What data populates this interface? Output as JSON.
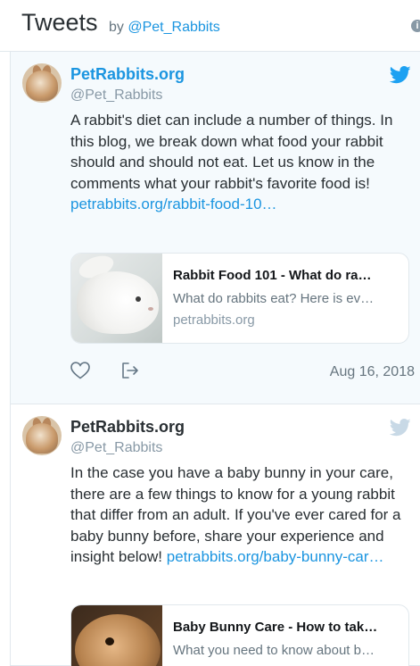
{
  "header": {
    "title": "Tweets",
    "by_label": "by",
    "handle": "@Pet_Rabbits",
    "info_icon": "info-icon"
  },
  "colors": {
    "link": "#1b95e0",
    "highlight_bg": "#f5fafd",
    "muted": "#8899a6"
  },
  "tweets": [
    {
      "name": "PetRabbits.org",
      "handle": "@Pet_Rabbits",
      "text": "A rabbit's diet can include a number of things. In this blog, we break down what food your rabbit should and should not eat. Let us know in the comments what your rabbit's favorite food is! ",
      "link": "petrabbits.org/rabbit-food-10…",
      "card": {
        "title": "Rabbit Food 101 - What do ra…",
        "description": "What do rabbits eat? Here is ev…",
        "domain": "petrabbits.org"
      },
      "date": "Aug 16, 2018",
      "icons": [
        "rabbit-avatar",
        "twitter-bird-icon",
        "heart-icon",
        "share-icon"
      ]
    },
    {
      "name": "PetRabbits.org",
      "handle": "@Pet_Rabbits",
      "text": "In the case you have a baby bunny in your care, there are a few things to know for a young rabbit that differ from an adult. If you've ever cared for a baby bunny before, share your experience and insight below! ",
      "link": "petrabbits.org/baby-bunny-car…",
      "card": {
        "title": "Baby Bunny Care - How to tak…",
        "description": "What you need to know about b…"
      },
      "icons": [
        "rabbit-avatar",
        "twitter-bird-icon"
      ]
    }
  ]
}
